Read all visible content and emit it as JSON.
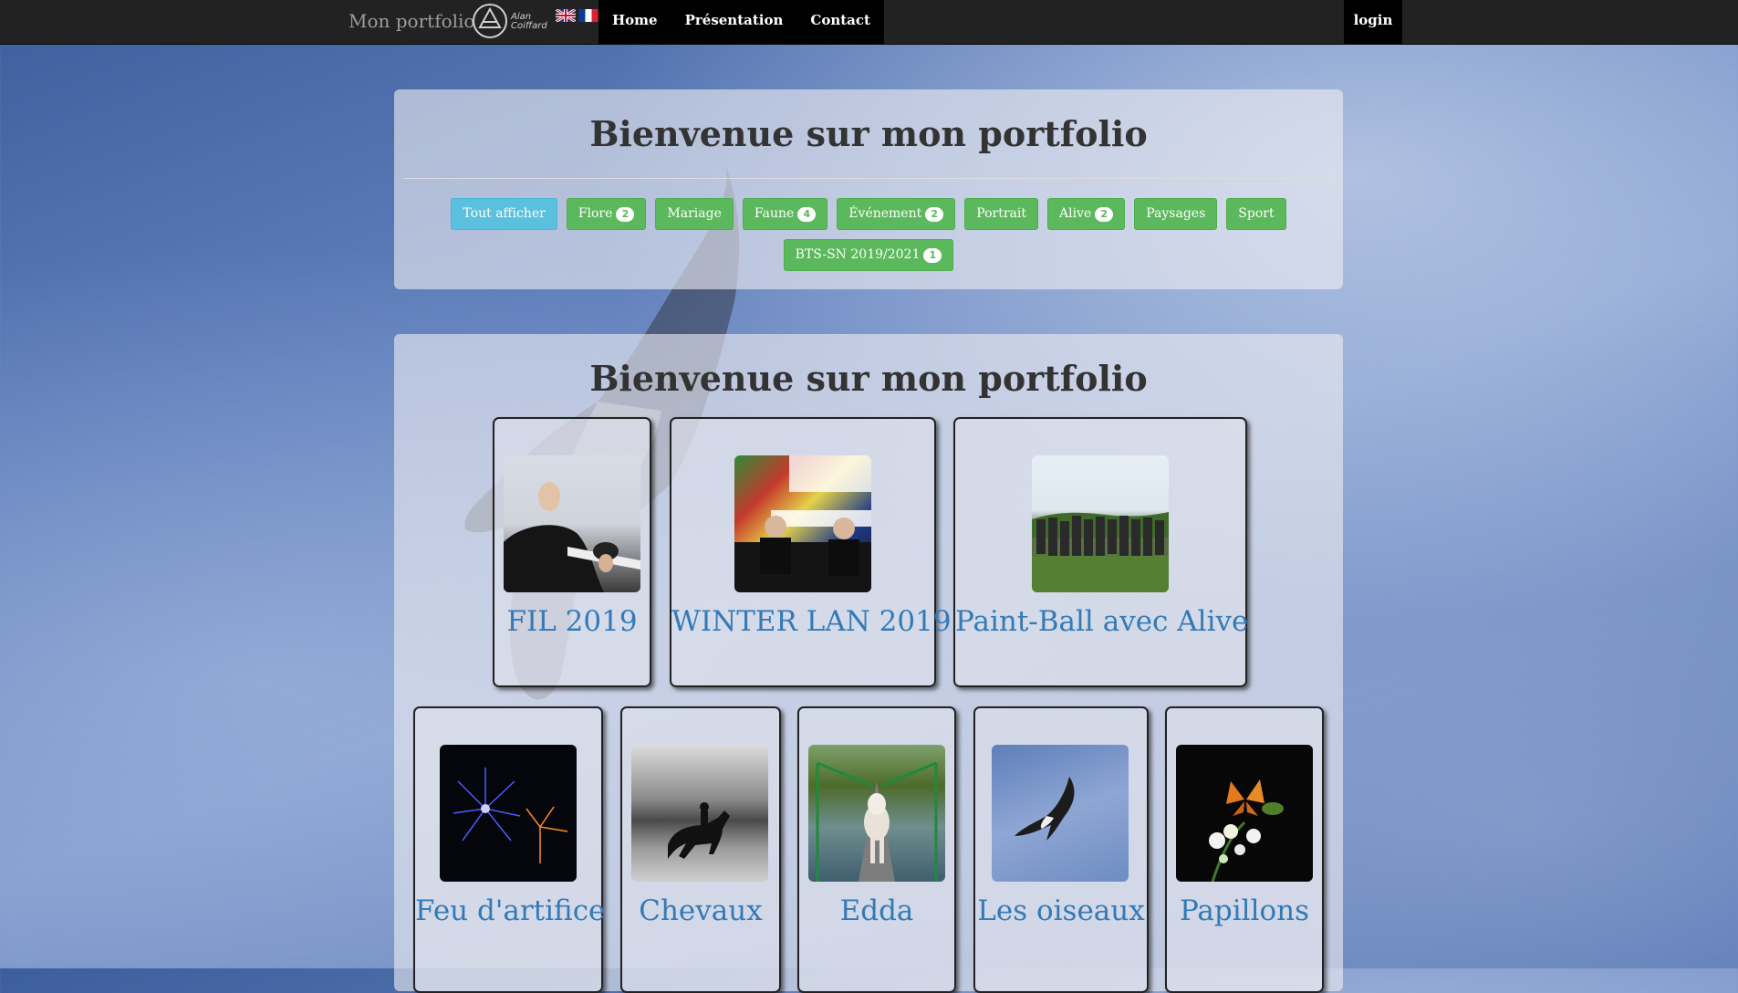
{
  "navbar": {
    "brand": "Mon portfolio",
    "logo_text_line1": "Alan",
    "logo_text_line2": "Coiffard",
    "links": [
      "Home",
      "Présentation",
      "Contact"
    ],
    "login": "login"
  },
  "filters_panel": {
    "title": "Bienvenue sur mon portfolio",
    "buttons": [
      {
        "label": "Tout afficher",
        "count": null,
        "active": true
      },
      {
        "label": "Flore",
        "count": "2"
      },
      {
        "label": "Mariage",
        "count": null
      },
      {
        "label": "Faune",
        "count": "4"
      },
      {
        "label": "Événement",
        "count": "2"
      },
      {
        "label": "Portrait",
        "count": null
      },
      {
        "label": "Alive",
        "count": "2"
      },
      {
        "label": "Paysages",
        "count": null
      },
      {
        "label": "Sport",
        "count": null
      },
      {
        "label": "BTS-SN 2019/2021",
        "count": "1"
      }
    ]
  },
  "gallery": {
    "title": "Bienvenue sur mon portfolio",
    "albums": [
      {
        "label": "FIL 2019"
      },
      {
        "label": "WINTER LAN 2019"
      },
      {
        "label": "Paint-Ball avec Alive"
      },
      {
        "label": "Feu d'artifice"
      },
      {
        "label": "Chevaux"
      },
      {
        "label": "Edda"
      },
      {
        "label": "Les oiseaux"
      },
      {
        "label": "Papillons"
      }
    ]
  },
  "colors": {
    "navbar_bg": "#222222",
    "button_green": "#5cb85c",
    "button_active": "#5bc0de",
    "link_blue": "#337ab7"
  }
}
